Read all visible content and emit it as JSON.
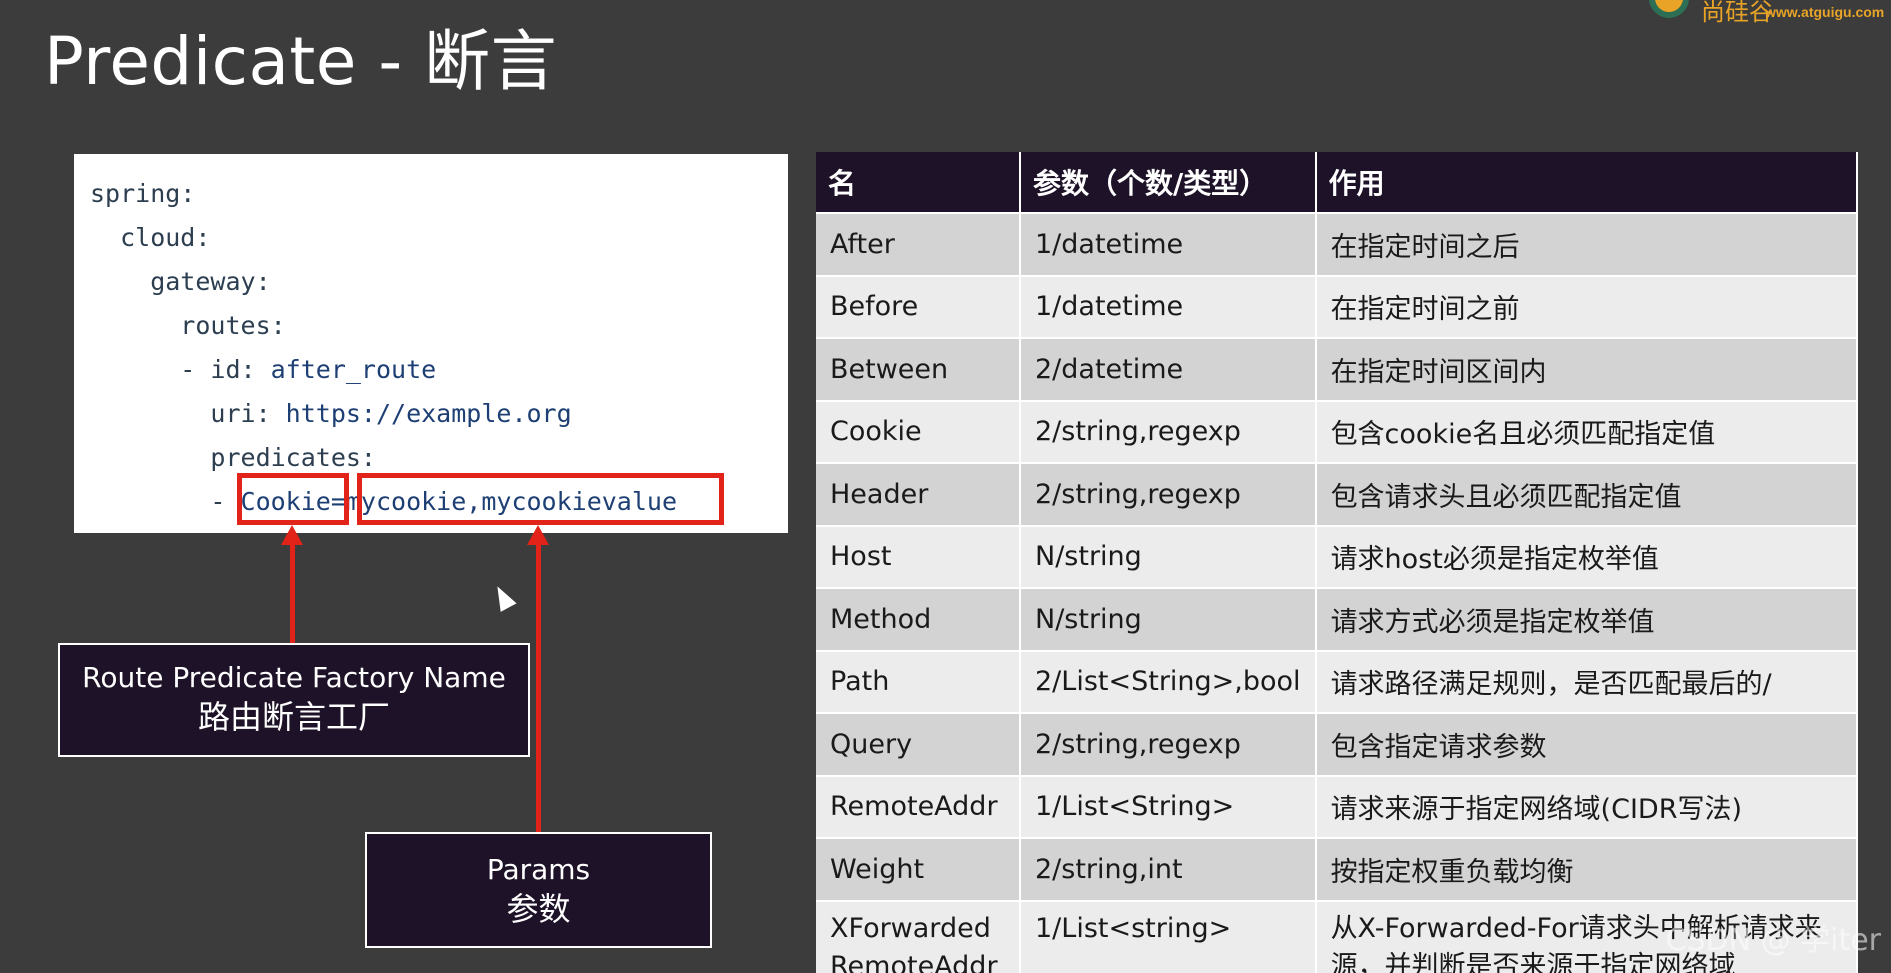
{
  "slide": {
    "title": "Predicate - 断言",
    "logo_text": "尚硅谷",
    "logo_url": "www.atguigu.com",
    "watermark": "CSDN @ 学iter"
  },
  "code": {
    "lines": [
      {
        "key": "spring:",
        "value": ""
      },
      {
        "key": "  cloud:",
        "value": ""
      },
      {
        "key": "    gateway:",
        "value": ""
      },
      {
        "key": "      routes:",
        "value": ""
      },
      {
        "key": "      - id: ",
        "value": "after_route"
      },
      {
        "key": "        uri: ",
        "value": "https://example.org"
      },
      {
        "key": "        predicates:",
        "value": ""
      },
      {
        "key": "        - ",
        "value": "Cookie=mycookie,mycookievalue"
      }
    ]
  },
  "callouts": {
    "factory_en": "Route Predicate Factory Name",
    "factory_zh": "路由断言工厂",
    "params_en": "Params",
    "params_zh": "参数"
  },
  "table": {
    "headers": [
      "名",
      "参数（个数/类型）",
      "作用"
    ],
    "rows": [
      [
        "After",
        "1/datetime",
        "在指定时间之后"
      ],
      [
        "Before",
        "1/datetime",
        "在指定时间之前"
      ],
      [
        "Between",
        "2/datetime",
        "在指定时间区间内"
      ],
      [
        "Cookie",
        "2/string,regexp",
        "包含cookie名且必须匹配指定值"
      ],
      [
        "Header",
        "2/string,regexp",
        "包含请求头且必须匹配指定值"
      ],
      [
        "Host",
        "N/string",
        "请求host必须是指定枚举值"
      ],
      [
        "Method",
        "N/string",
        "请求方式必须是指定枚举值"
      ],
      [
        "Path",
        "2/List<String>,bool",
        "请求路径满足规则，是否匹配最后的/"
      ],
      [
        "Query",
        "2/string,regexp",
        "包含指定请求参数"
      ],
      [
        "RemoteAddr",
        "1/List<String>",
        "请求来源于指定网络域(CIDR写法)"
      ],
      [
        "Weight",
        "2/string,int",
        "按指定权重负载均衡"
      ],
      [
        "XForwarded RemoteAddr",
        "1/List<string>",
        "从X-Forwarded-For请求头中解析请求来源，并判断是否来源于指定网络域"
      ]
    ]
  },
  "colors": {
    "background": "#3c3c3c",
    "header_bg": "#1e1228",
    "highlight": "#e2231a",
    "row_odd": "#d3d3d3",
    "row_even": "#ececec"
  }
}
